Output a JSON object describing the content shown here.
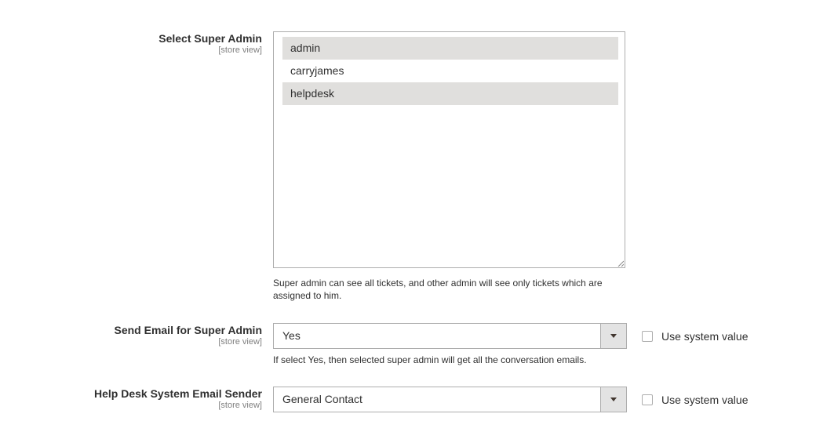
{
  "super_admin": {
    "label": "Select Super Admin",
    "scope": "[store view]",
    "options": [
      {
        "text": "admin",
        "selected": true
      },
      {
        "text": "carryjames",
        "selected": false
      },
      {
        "text": "helpdesk",
        "selected": true
      }
    ],
    "note": "Super admin can see all tickets, and other admin will see only tickets which are assigned to him."
  },
  "send_email": {
    "label": "Send Email for Super Admin",
    "scope": "[store view]",
    "value": "Yes",
    "use_system_label": "Use system value",
    "note": "If select Yes, then selected super admin will get all the conversation emails."
  },
  "email_sender": {
    "label": "Help Desk System Email Sender",
    "scope": "[store view]",
    "value": "General Contact",
    "use_system_label": "Use system value"
  }
}
